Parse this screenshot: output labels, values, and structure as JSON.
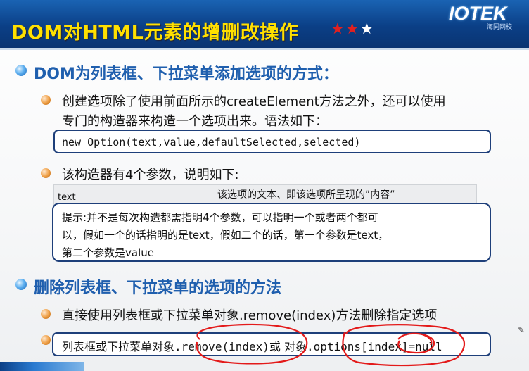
{
  "header": {
    "title": "DOM对HTML元素的增删改操作",
    "stars_filled": 2,
    "stars_total": 3,
    "logo_text": "IOTEK",
    "logo_sub": "海同网校"
  },
  "section1": {
    "heading": "DOM为列表框、下拉菜单添加选项的方式：",
    "point1_line1": "创建选项除了使用前面所示的createElement方法之外，还可以使用",
    "point1_line2": "专门的构造器来构造一个选项出来。语法如下：",
    "code": "new Option(text,value,defaultSelected,selected)",
    "point2": "该构造器有4个参数，说明如下:",
    "table_param": "text",
    "table_desc": "该选项的文本、即该选项所呈现的”内容”",
    "hint_line1": "提示:并不是每次构造都需指明4个参数，可以指明一个或者两个都可",
    "hint_line2": "以，假如一个的话指明的是text，假如二个的话，第一个参数是text，",
    "hint_line3": "第二个参数是value"
  },
  "section2": {
    "heading": "删除列表框、下拉菜单的选项的方法",
    "point1": "直接使用列表框或下拉菜单对象.remove(index)方法删除指定选项",
    "box_prefix": "列表框或下拉菜单对象",
    "box_method1": ".remove(index)",
    "box_or": "或 对象",
    "box_method2": ".options[index]=null"
  },
  "colors": {
    "title_yellow": "#ffe000",
    "heading_blue": "#1f5fae",
    "annotation_red": "#e31a1a"
  }
}
